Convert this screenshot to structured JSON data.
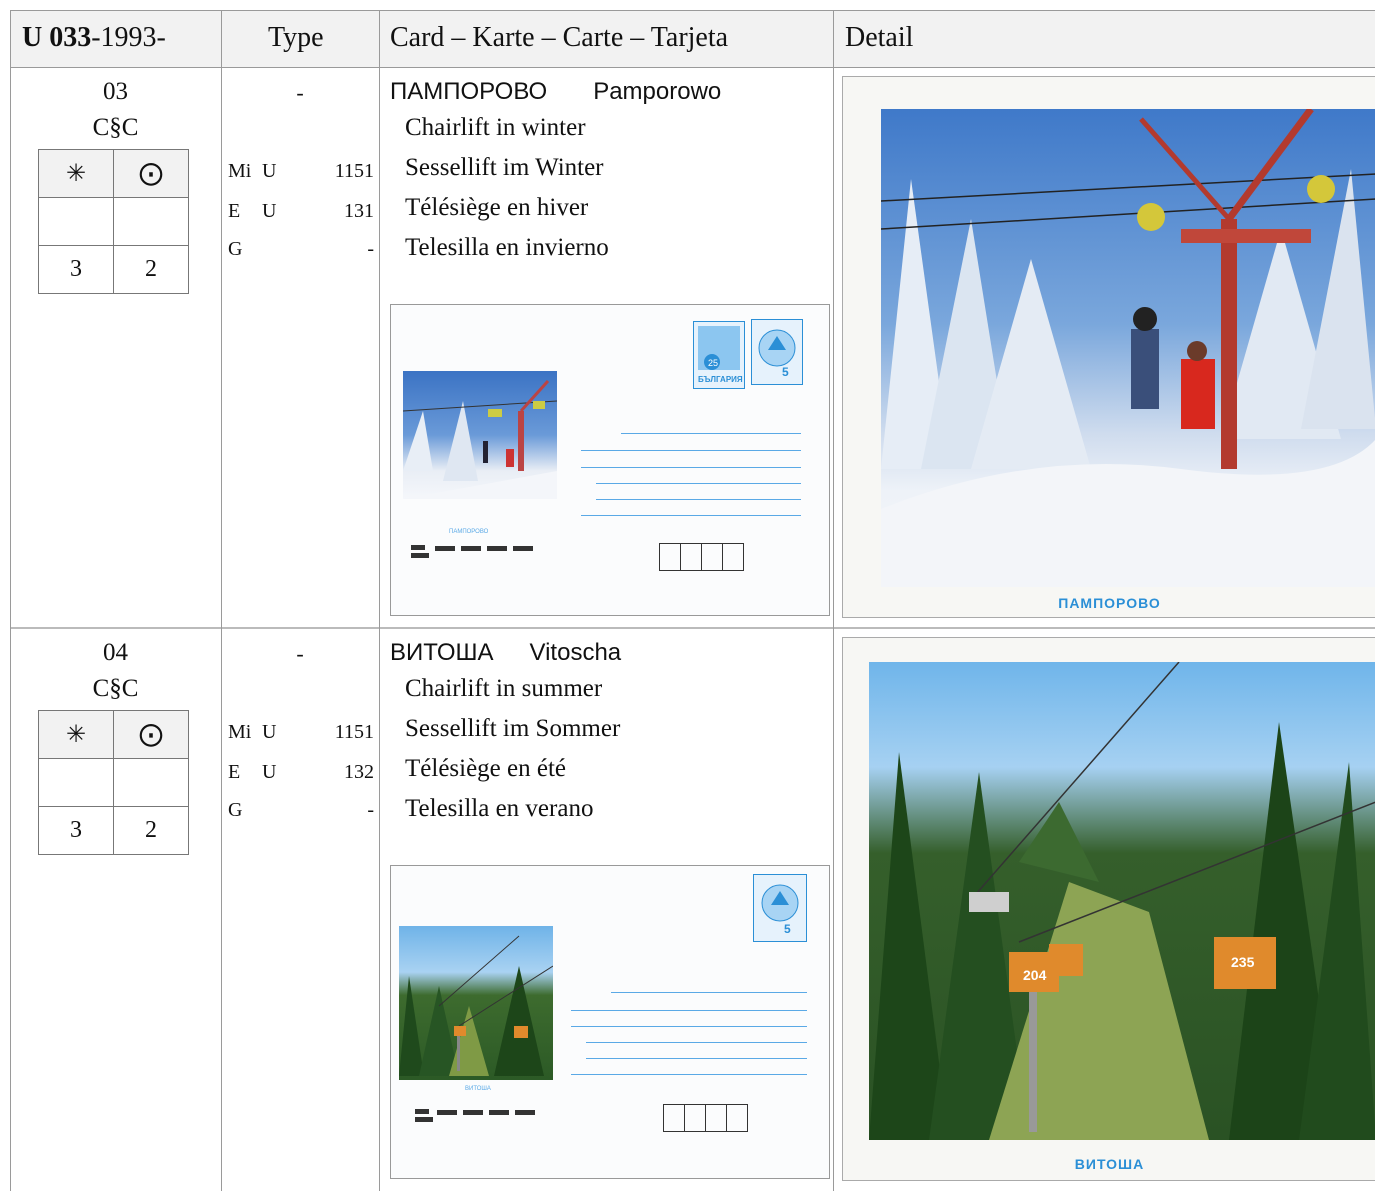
{
  "header": {
    "catalog_bold": "U 033",
    "catalog_rest": "-1993-",
    "type": "Type",
    "card": "Card – Karte – Carte – Tarjeta",
    "detail": "Detail"
  },
  "rows": [
    {
      "number": "03",
      "code": "C§C",
      "mint_symbol": "✳",
      "used_symbol": "⨀",
      "mint_value": "3",
      "used_value": "2",
      "type_dash": "-",
      "type_rows": [
        {
          "a": "Mi",
          "b": "U",
          "c": "1151"
        },
        {
          "a": "E",
          "b": "U",
          "c": "131"
        },
        {
          "a": "G",
          "b": "",
          "c": "-"
        }
      ],
      "title_cyr": "ПАМПОРОВО",
      "title_lat": "Pamporowo",
      "desc": [
        "Chairlift in winter",
        "Sessellift im Winter",
        "Télésiège en hiver",
        "Telesilla en invierno"
      ],
      "envelope_stamp": "25 БЪЛГАРИЯ",
      "envelope_caption": "ПАМПОРОВО",
      "detail_caption": "ПАМПОРОВО"
    },
    {
      "number": "04",
      "code": "C§C",
      "mint_symbol": "✳",
      "used_symbol": "⨀",
      "mint_value": "3",
      "used_value": "2",
      "type_dash": "-",
      "type_rows": [
        {
          "a": "Mi",
          "b": "U",
          "c": "1151"
        },
        {
          "a": "E",
          "b": "U",
          "c": "132"
        },
        {
          "a": "G",
          "b": "",
          "c": "-"
        }
      ],
      "title_cyr": "ВИТОША",
      "title_lat": "Vitoscha",
      "desc": [
        "Chairlift in summer",
        "Sessellift im Sommer",
        "Télésiège en été",
        "Telesilla en verano"
      ],
      "envelope_caption": "ВИТОША",
      "detail_caption": "ВИТОША"
    }
  ],
  "gondola_numbers": [
    "204",
    "235"
  ],
  "colors": {
    "border": "#9a9a9a",
    "header_bg": "#f2f2f2",
    "caption_blue": "#2b8fd6"
  }
}
